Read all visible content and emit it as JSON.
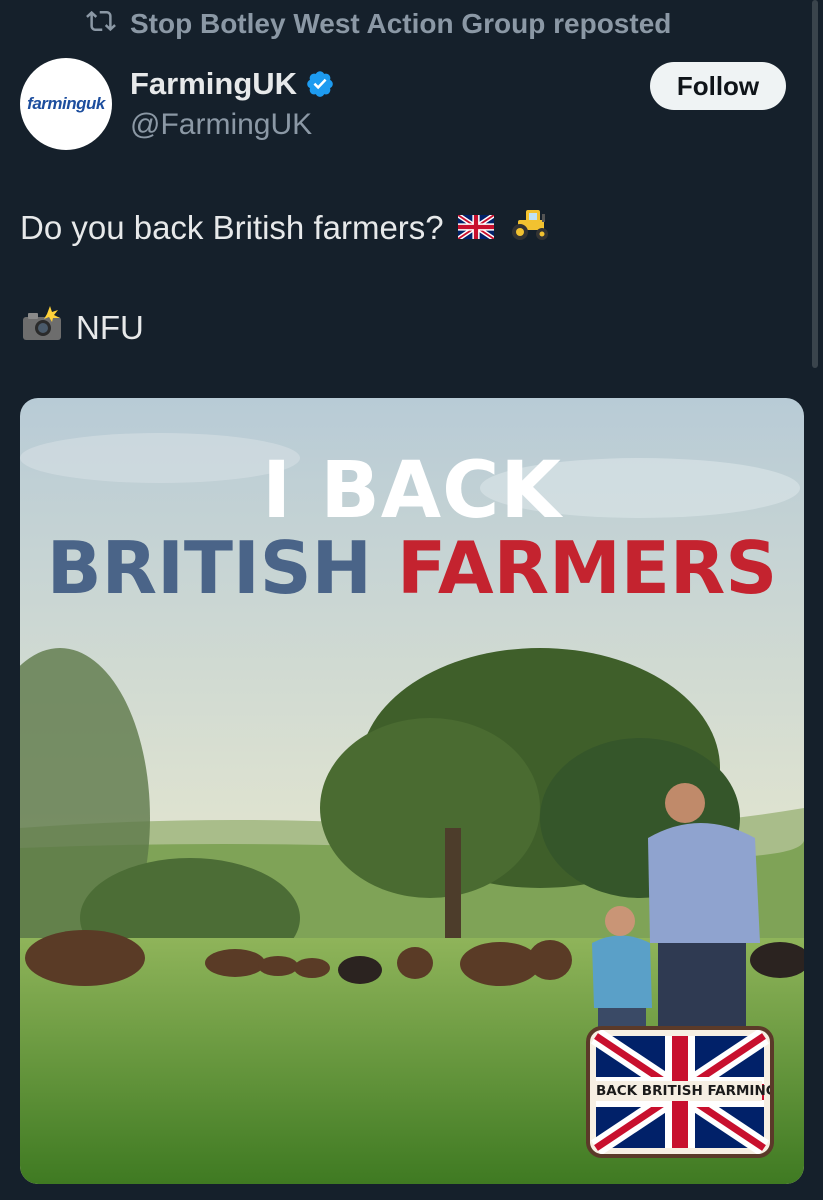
{
  "repost": {
    "text": "Stop Botley West Action Group reposted",
    "icon": "repost-icon"
  },
  "author": {
    "avatar_text": "farminguk",
    "display_name": "FarmingUK",
    "handle": "@FarmingUK",
    "verified_icon": "verified-badge-icon"
  },
  "follow_button": {
    "label": "Follow"
  },
  "tweet": {
    "line1": "Do you back British farmers?",
    "line1_emojis": [
      "uk-flag-icon",
      "tractor-icon"
    ],
    "line2": "NFU",
    "line2_emoji": "camera-flash-icon"
  },
  "media": {
    "headline_line1": "I BACK",
    "headline_word_blue": "BRITISH",
    "headline_word_red": "FARMERS",
    "badge_text": "BACK BRITISH FARMING"
  },
  "colors": {
    "background": "#15202b",
    "accent_blue": "#4a6488",
    "accent_red": "#c4232f",
    "verified": "#1d9bf0"
  }
}
